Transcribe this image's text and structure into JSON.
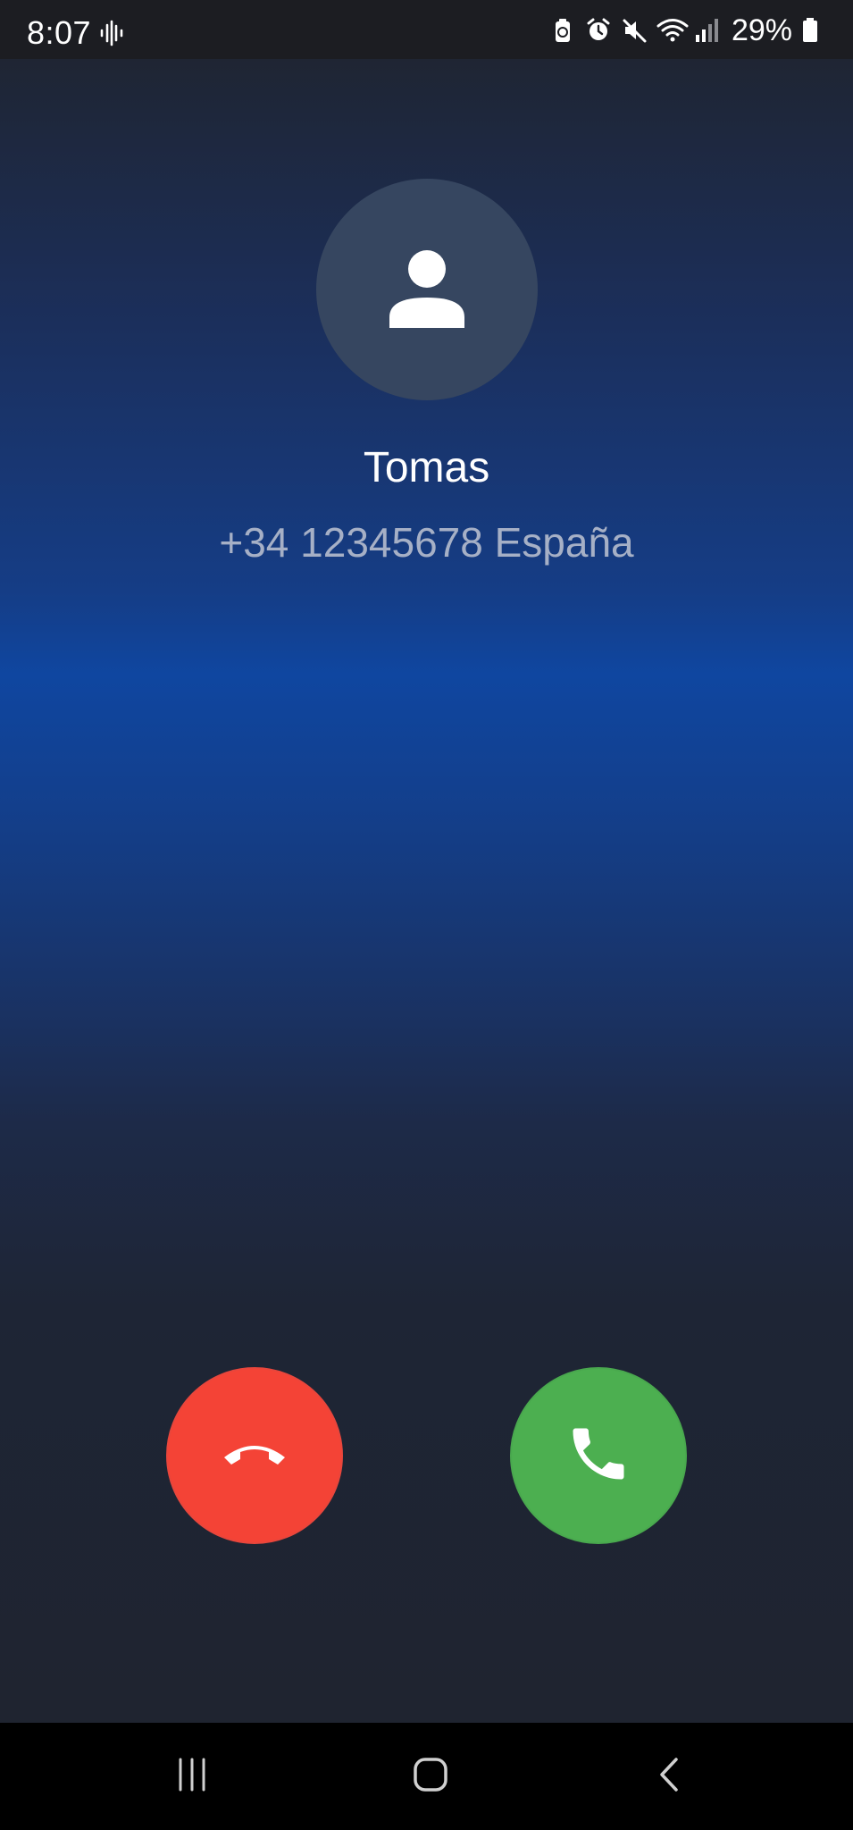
{
  "status_bar": {
    "time": "8:07",
    "battery_percent": "29%",
    "left_icons": [
      "audio-wave-icon"
    ],
    "right_icons": [
      "battery-saver-icon",
      "alarm-icon",
      "mute-icon",
      "wifi-icon",
      "signal-icon",
      "battery-icon"
    ]
  },
  "caller": {
    "name": "Tomas",
    "number": "+34 12345678 España",
    "avatar_icon": "person-icon"
  },
  "actions": {
    "decline": {
      "icon": "hang-up-icon",
      "color": "#f44336"
    },
    "answer": {
      "icon": "phone-icon",
      "color": "#4caf50"
    }
  },
  "nav_bar": {
    "items": [
      "recents-icon",
      "home-icon",
      "back-icon"
    ]
  }
}
